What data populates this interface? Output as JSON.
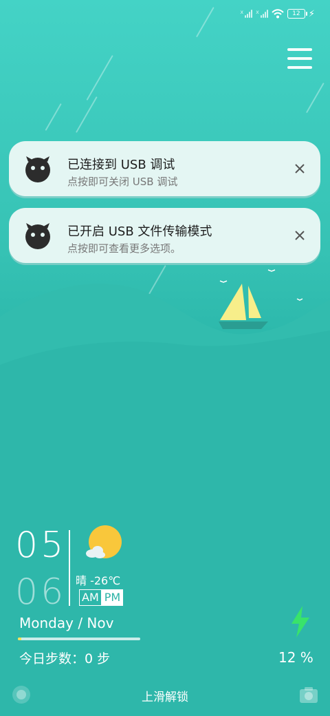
{
  "status_bar": {
    "battery_level": "12",
    "icons": [
      "signal-icon",
      "signal-icon",
      "wifi-icon",
      "battery-icon",
      "charging-icon"
    ]
  },
  "notifications": [
    {
      "title": "已连接到 USB 调试",
      "subtitle": "点按即可关闭 USB 调试",
      "icon": "android-icon"
    },
    {
      "title": "已开启 USB 文件传输模式",
      "subtitle": "点按即可查看更多选项。",
      "icon": "android-icon"
    }
  ],
  "clock": {
    "hour": "05",
    "minute": "06",
    "weather": "晴 -26℃",
    "am_label": "AM",
    "pm_label": "PM",
    "date": "Monday / Nov",
    "steps": "今日步数：0 步",
    "step_progress_fraction": 0.03
  },
  "battery": {
    "percent_text": "12 %"
  },
  "lock": {
    "hint": "上滑解锁"
  },
  "colors": {
    "background_top": "#44d3c6",
    "background_bottom": "#22ad9f",
    "sail": "#f7ee8a",
    "notification_bg": "#e4f6f3"
  }
}
